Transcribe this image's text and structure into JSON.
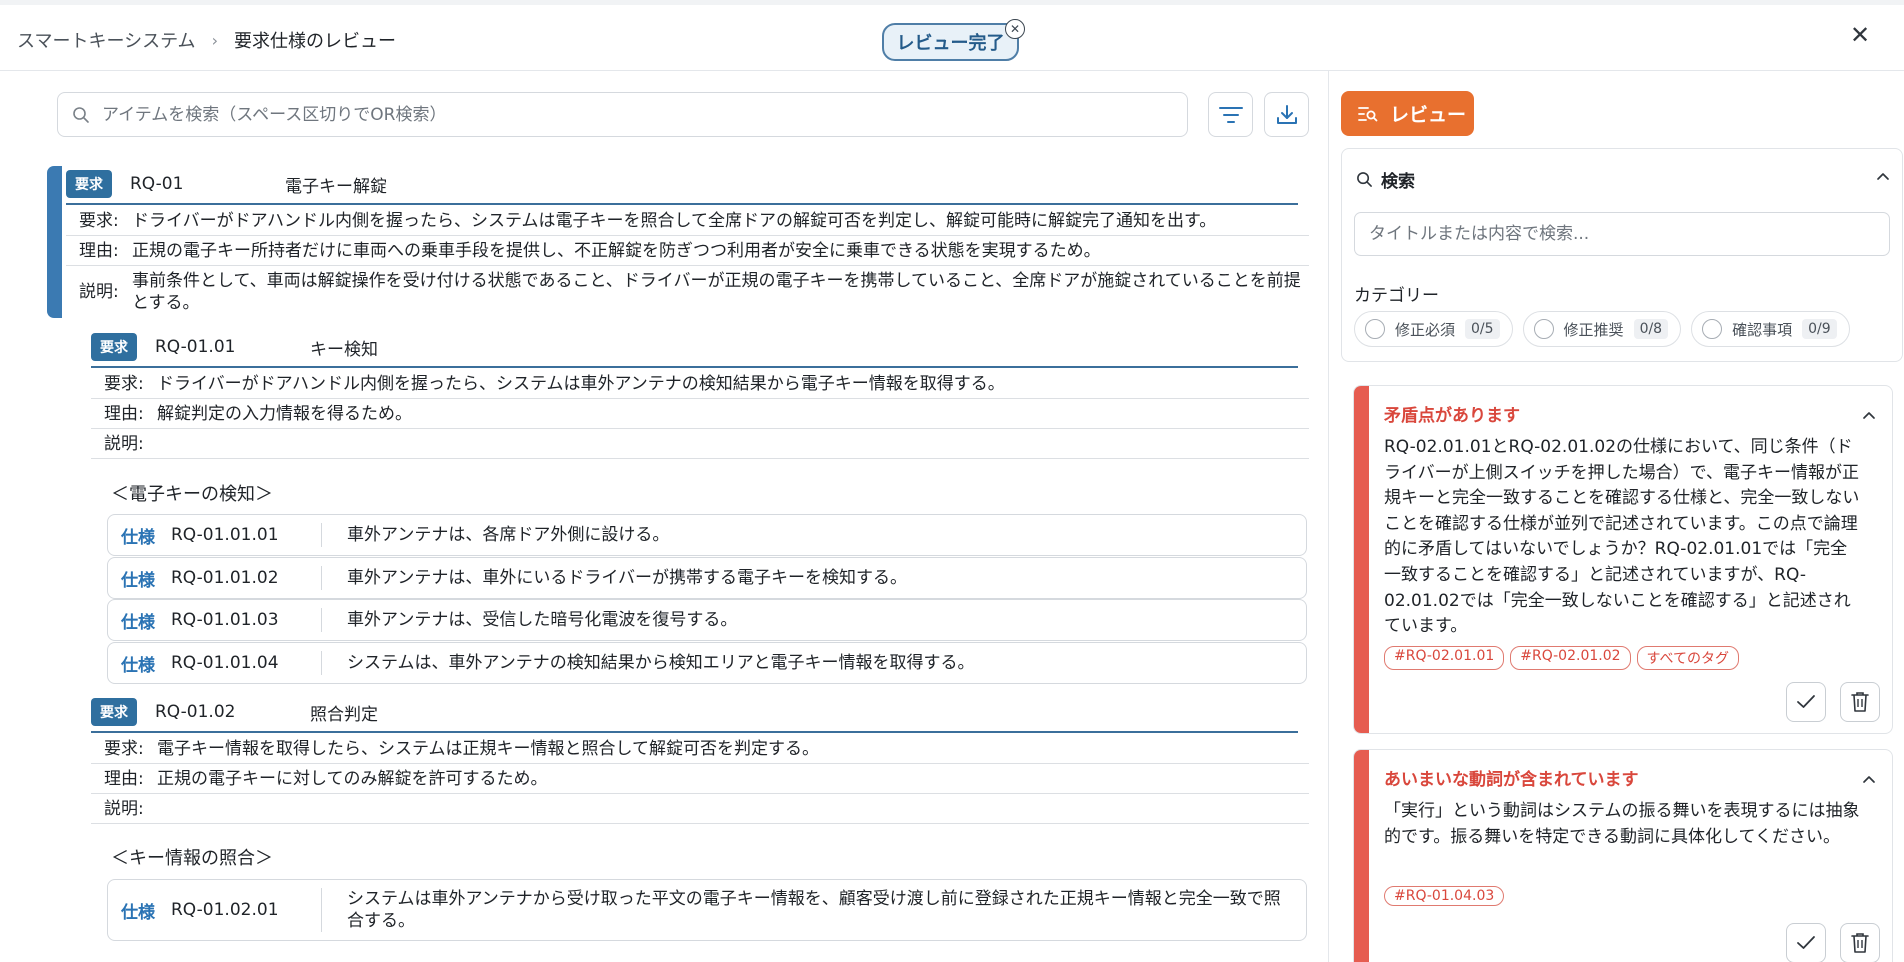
{
  "header": {
    "breadcrumb_root": "スマートキーシステム",
    "breadcrumb_sep": "›",
    "breadcrumb_current": "要求仕様のレビュー",
    "review_done_label": "レビュー完了",
    "close_glyph": "✕",
    "badge_close_glyph": "✕"
  },
  "search": {
    "placeholder": "アイテムを検索（スペース区切りでOR検索）"
  },
  "requirements": {
    "r1": {
      "tag": "要求",
      "id": "RQ-01",
      "title": "電子キー解錠",
      "req_label": "要求:",
      "req_text": "ドライバーがドアハンドル内側を握ったら、システムは電子キーを照合して全席ドアの解錠可否を判定し、解錠可能時に解錠完了通知を出す。",
      "reason_label": "理由:",
      "reason_text": "正規の電子キー所持者だけに車両への乗車手段を提供し、不正解錠を防ぎつつ利用者が安全に乗車できる状態を実現するため。",
      "desc_label": "説明:",
      "desc_text": "事前条件として、車両は解錠操作を受け付ける状態であること、ドライバーが正規の電子キーを携帯していること、全席ドアが施錠されていることを前提とする。"
    },
    "r2": {
      "tag": "要求",
      "id": "RQ-01.01",
      "title": "キー検知",
      "req_label": "要求:",
      "req_text": "ドライバーがドアハンドル内側を握ったら、システムは車外アンテナの検知結果から電子キー情報を取得する。",
      "reason_label": "理由:",
      "reason_text": "解錠判定の入力情報を得るため。",
      "desc_label": "説明:",
      "desc_text": "",
      "group": "＜電子キーの検知＞",
      "specs": [
        {
          "tag": "仕様",
          "id": "RQ-01.01.01",
          "text": "車外アンテナは、各席ドア外側に設ける。"
        },
        {
          "tag": "仕様",
          "id": "RQ-01.01.02",
          "text": "車外アンテナは、車外にいるドライバーが携帯する電子キーを検知する。"
        },
        {
          "tag": "仕様",
          "id": "RQ-01.01.03",
          "text": "車外アンテナは、受信した暗号化電波を復号する。"
        },
        {
          "tag": "仕様",
          "id": "RQ-01.01.04",
          "text": "システムは、車外アンテナの検知結果から検知エリアと電子キー情報を取得する。"
        }
      ]
    },
    "r3": {
      "tag": "要求",
      "id": "RQ-01.02",
      "title": "照合判定",
      "req_label": "要求:",
      "req_text": "電子キー情報を取得したら、システムは正規キー情報と照合して解錠可否を判定する。",
      "reason_label": "理由:",
      "reason_text": "正規の電子キーに対してのみ解錠を許可するため。",
      "desc_label": "説明:",
      "desc_text": "",
      "group": "＜キー情報の照合＞",
      "specs": [
        {
          "tag": "仕様",
          "id": "RQ-01.02.01",
          "text": "システムは車外アンテナから受け取った平文の電子キー情報を、顧客受け渡し前に登録された正規キー情報と完全一致で照合する。"
        }
      ]
    }
  },
  "right_panel": {
    "review_button": "レビュー",
    "search_title": "検索",
    "search_placeholder": "タイトルまたは内容で検索...",
    "category_label": "カテゴリー",
    "chips": [
      {
        "label": "修正必須",
        "count": "0/5"
      },
      {
        "label": "修正推奨",
        "count": "0/8"
      },
      {
        "label": "確認事項",
        "count": "0/9"
      }
    ],
    "issues": [
      {
        "title": "矛盾点があります",
        "text": "RQ-02.01.01とRQ-02.01.02の仕様において、同じ条件（ドライバーが上側スイッチを押した場合）で、電子キー情報が正規キーと完全一致することを確認する仕様と、完全一致しないことを確認する仕様が並列で記述されています。この点で論理的に矛盾してはいないでしょうか？RQ-02.01.01では「完全一致することを確認する」と記述されていますが、RQ-02.01.02では「完全一致しないことを確認する」と記述されています。",
        "tags": [
          "#RQ-02.01.01",
          "#RQ-02.01.02",
          "すべてのタグ"
        ]
      },
      {
        "title": "あいまいな動詞が含まれています",
        "text": "「実行」という動詞はシステムの振る舞いを表現するには抽象的です。振る舞いを特定できる動詞に具体化してください。",
        "tags": [
          "#RQ-01.04.03"
        ]
      }
    ]
  },
  "colors": {
    "accent_blue": "#3b7ab2",
    "review_orange": "#e8702f",
    "issue_red": "#e65c50",
    "spec_blue": "#2a73b4"
  },
  "icons": [
    "search-icon",
    "filter-icon",
    "download-icon",
    "review-icon",
    "chevron-up-icon",
    "check-icon",
    "trash-icon",
    "close-icon"
  ]
}
